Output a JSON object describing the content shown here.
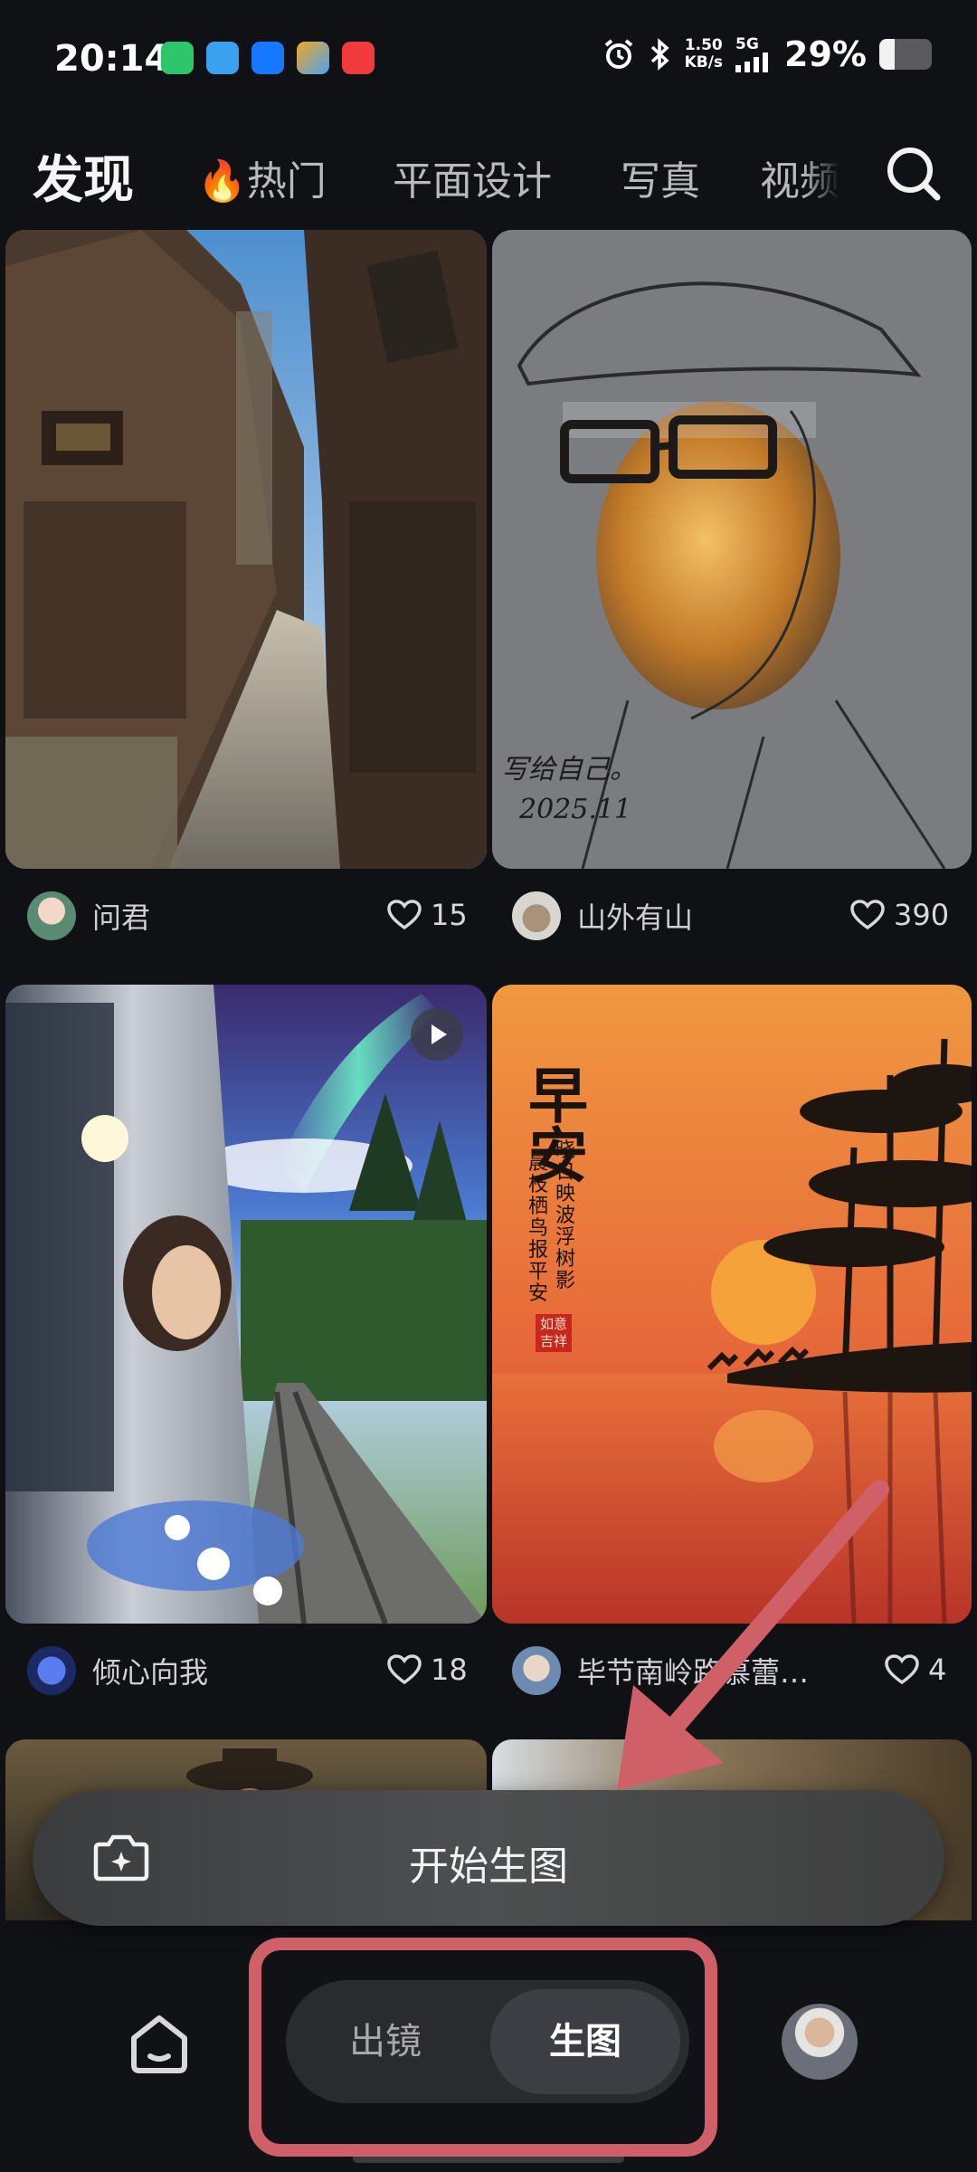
{
  "status_bar": {
    "time": "20:14",
    "speed_value": "1.50",
    "speed_unit": "KB/s",
    "network": "5G",
    "battery_pct": "29%",
    "battery_level": 0.29
  },
  "tabs": {
    "active": "发现",
    "items": [
      "🔥热门",
      "平面设计",
      "写真",
      "视频"
    ]
  },
  "feed": [
    {
      "author": "问君",
      "likes": "15"
    },
    {
      "author": "山外有山",
      "likes": "390"
    },
    {
      "author": "倾心向我",
      "likes": "18"
    },
    {
      "author": "毕节南岭路慕蕾…",
      "likes": "4"
    }
  ],
  "artwork_text": {
    "sketch_signature_line1": "写给自己。",
    "sketch_signature_line2": "2025.11",
    "poster_title": "早安",
    "poster_col1": "晨枝栖鸟报平安",
    "poster_col2": "晓日映波浮树影",
    "poster_seal": "如意吉祥"
  },
  "generate_bar": {
    "label": "开始生图"
  },
  "bottom_nav": {
    "segment_left": "出镜",
    "segment_right": "生图",
    "selected": "生图"
  },
  "colors": {
    "background": "#101115",
    "annotation": "#d06068"
  }
}
